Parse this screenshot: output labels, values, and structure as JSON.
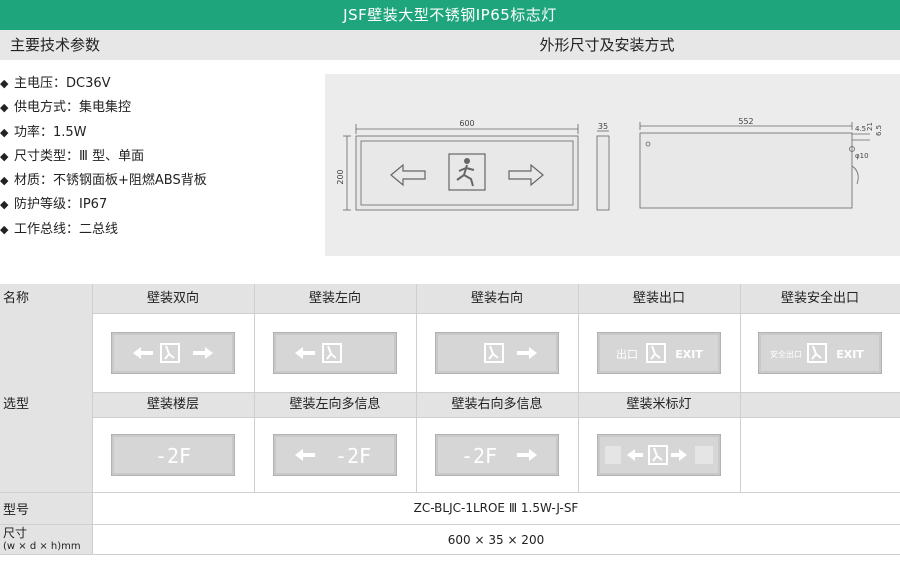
{
  "banner": {
    "title": "JSF壁装大型不锈钢IP65标志灯"
  },
  "section": {
    "tech_params": "主要技术参数",
    "dimensions_install": "外形尺寸及安装方式"
  },
  "specs": [
    "主电压：DC36V",
    "供电方式：集电集控",
    "功率：1.5W",
    "尺寸类型：Ⅲ 型、单面",
    "材质：不锈钢面板+阻燃ABS背板",
    "防护等级：IP67",
    "工作总线：二总线"
  ],
  "spec_marker": "◆",
  "drawing": {
    "width_label": "600",
    "height_label": "200",
    "depth_label": "35",
    "side_length_label": "552",
    "dim_4_5": "4.5",
    "dim_21": "21",
    "dim_6_5": "6.5",
    "dim_phi10": "φ10"
  },
  "table": {
    "name_label": "名称",
    "selection_label": "选型",
    "model_label": "型号",
    "size_label_1": "尺寸",
    "size_label_2": "(w × d × h)mm",
    "row1_headers": [
      "壁装双向",
      "壁装左向",
      "壁装右向",
      "壁装出口",
      "壁装安全出口"
    ],
    "row2_headers": [
      "壁装楼层",
      "壁装左向多信息",
      "壁装右向多信息",
      "壁装米标灯"
    ],
    "model_value": "ZC-BLJC-1LROE Ⅲ 1.5W-J-SF",
    "size_value": "600 × 35 × 200"
  },
  "signs": {
    "floor_text": "-2F",
    "exit_cn": "出口",
    "exit_en": "EXIT",
    "safe_exit_cn": "安全出口"
  },
  "colors": {
    "banner": "#1fa57c",
    "header_gray": "#e3e3e3",
    "panel_steel": "#c9c9c9"
  }
}
